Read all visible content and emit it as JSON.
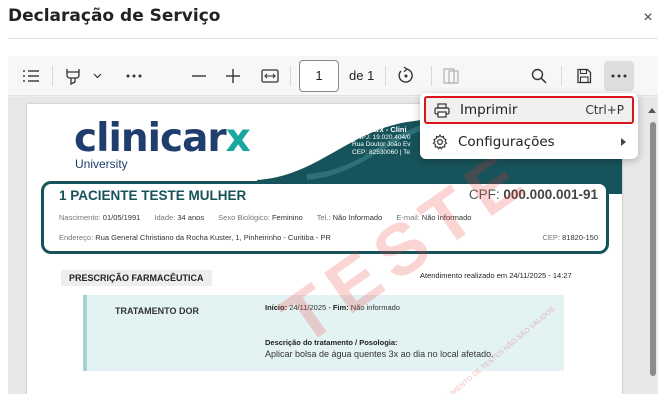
{
  "dialog": {
    "title": "Declaração de Serviço",
    "close_glyph": "×"
  },
  "toolbar": {
    "icons": [
      "list-icon",
      "highlighter-icon",
      "chevron-down-icon",
      "more-horizontal-icon",
      "zoom-out-icon",
      "zoom-in-icon",
      "fit-width-icon",
      "rotate-icon",
      "page-view-icon",
      "search-icon",
      "save-icon",
      "more-options-icon"
    ],
    "page_current": "1",
    "page_total_label": "de 1"
  },
  "menu": {
    "print_label": "Imprimir",
    "print_shortcut": "Ctrl+P",
    "settings_label": "Configurações",
    "accent_color": "#d9141b"
  },
  "document": {
    "brand_name_a": "clinicar",
    "brand_name_b": "x",
    "brand_sub": "University",
    "clinic": {
      "name": "Clinicarx - Clini",
      "cnpj": "CNPJ: 19.020.404/0",
      "address": "Rua Doutor João Ev",
      "cep": "CEP: 82530060 | Te"
    },
    "patient": {
      "name": "1 PACIENTE TESTE MULHER",
      "cpf_label": "CPF:",
      "cpf_value": "000.000.001-91",
      "birth_label": "Nascimento:",
      "birth_value": "01/05/1991",
      "age_label": "Idade:",
      "age_value": "34 anos",
      "sex_label": "Sexo Biológico:",
      "sex_value": "Feminino",
      "tel_label": "Tel.:",
      "tel_value": "Não Informado",
      "email_label": "E-mail:",
      "email_value": "Não Informado",
      "address_label": "Endereço:",
      "address_value": "Rua General Christiano da Rocha Kuster, 1, Pinheirinho - Curitiba - PR",
      "cep_label": "CEP:",
      "cep_value": "81820-150"
    },
    "prescription_label": "PRESCRIÇÃO FARMACÊUTICA",
    "attendance": "Atendimento realizado em 24/11/2025 - 14:27",
    "treatment": {
      "title": "TRATAMENTO DOR",
      "start_label": "Início:",
      "start_value": "24/11/2025",
      "end_label": "Fim:",
      "end_value": "Não informado",
      "desc_label": "Descrição do tratamento / Posologia:",
      "desc_value": "Aplicar bolsa de água quentes 3x ao dia no local afetado."
    },
    "watermark": "TESTE",
    "watermark_small": "DOCUMENTO DE TESTES NÃO SÃO VÁLIDOS"
  }
}
